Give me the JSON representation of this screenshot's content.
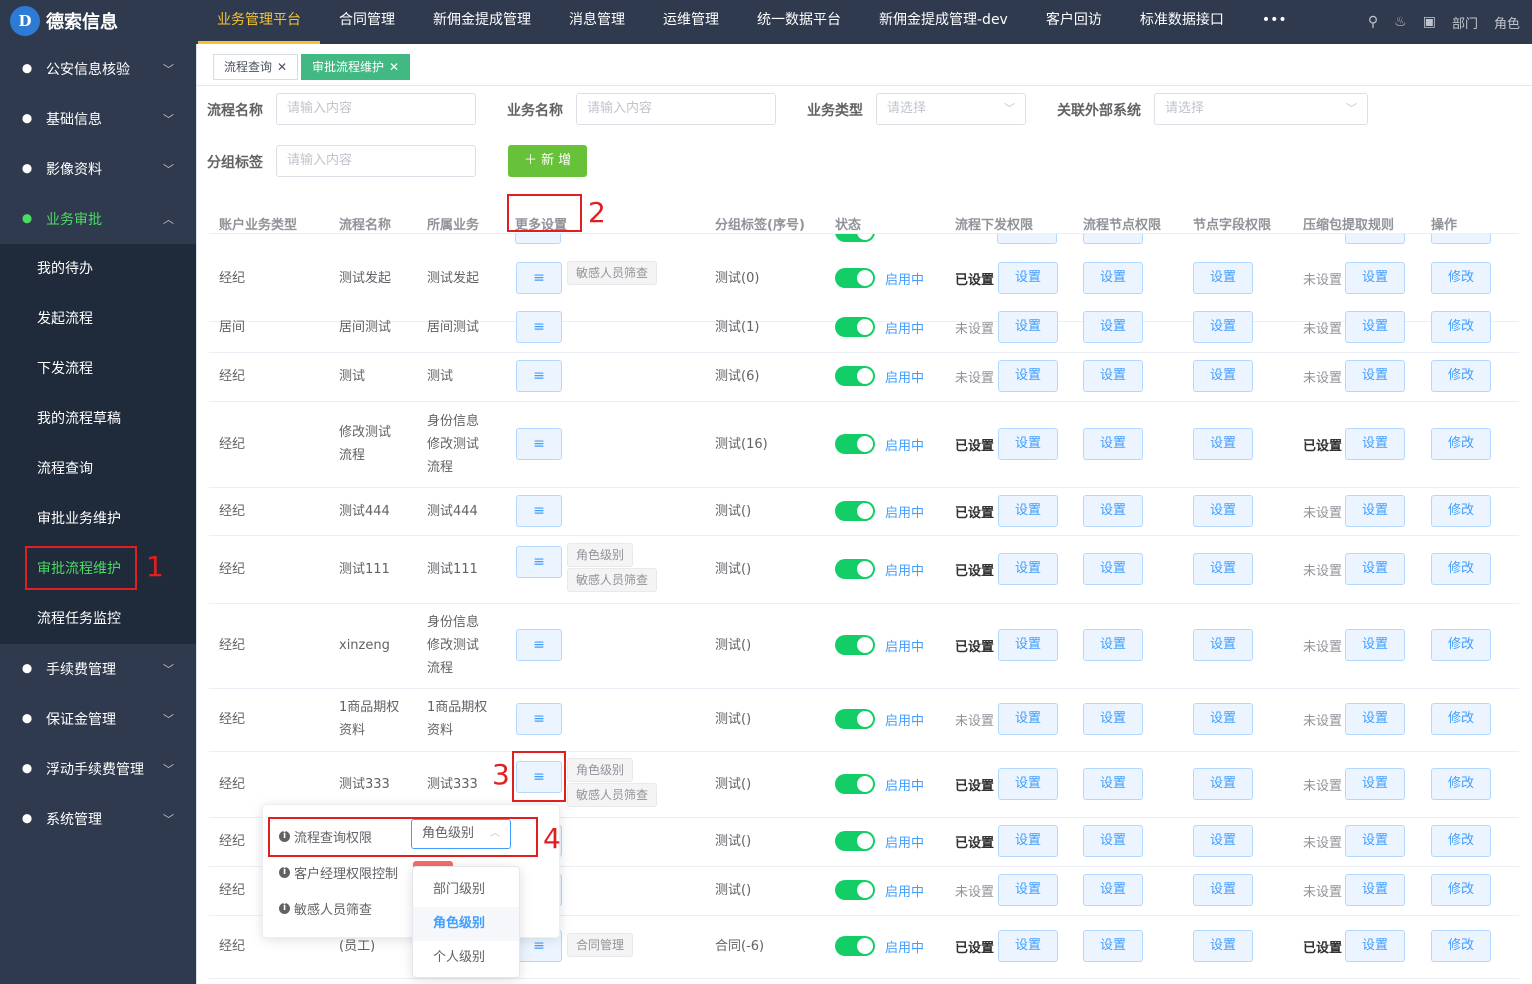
{
  "brand": {
    "name": "德索信息",
    "mark": "D"
  },
  "topnav": [
    "业务管理平台",
    "合同管理",
    "新佣金提成管理",
    "消息管理",
    "运维管理",
    "统一数据平台",
    "新佣金提成管理-dev",
    "客户回访",
    "标准数据接口",
    "•••"
  ],
  "topright": {
    "dept": "部门",
    "role": "角色"
  },
  "sidebar": {
    "groups": [
      "公安信息核验",
      "基础信息",
      "影像资料",
      "业务审批",
      "手续费管理",
      "保证金管理",
      "浮动手续费管理",
      "系统管理"
    ],
    "subs": [
      "我的待办",
      "发起流程",
      "下发流程",
      "我的流程草稿",
      "流程查询",
      "审批业务维护",
      "审批流程维护",
      "流程任务监控"
    ]
  },
  "tabs": [
    {
      "label": "流程查询"
    },
    {
      "label": "审批流程维护"
    }
  ],
  "filters": {
    "flow_name_label": "流程名称",
    "flow_name_ph": "请输入内容",
    "biz_name_label": "业务名称",
    "biz_name_ph": "请输入内容",
    "biz_type_label": "业务类型",
    "biz_type_ph": "请选择",
    "ext_sys_label": "关联外部系统",
    "ext_sys_ph": "请选择",
    "group_label": "分组标签",
    "group_ph": "请输入内容",
    "add_btn": "新 增"
  },
  "table": {
    "headers": [
      "账户业务类型",
      "流程名称",
      "所属业务",
      "更多设置",
      "分组标签(序号)",
      "状态",
      "流程下发权限",
      "流程节点权限",
      "节点字段权限",
      "压缩包提取规则",
      "操作"
    ],
    "status_on": "启用中",
    "set_btn": "设置",
    "edit_btn": "修改",
    "rows": [
      {
        "type": "经纪",
        "name": [
          "测试发起"
        ],
        "biz": [
          "测试发起"
        ],
        "tags": [
          "敏感人员筛查"
        ],
        "group": "测试(0)",
        "perm": "已设置",
        "zip": "未设置"
      },
      {
        "type": "居间",
        "name": [
          "居间测试"
        ],
        "biz": [
          "居间测试"
        ],
        "tags": [],
        "group": "测试(1)",
        "perm": "未设置",
        "zip": "未设置"
      },
      {
        "type": "经纪",
        "name": [
          "测试"
        ],
        "biz": [
          "测试"
        ],
        "tags": [],
        "group": "测试(6)",
        "perm": "未设置",
        "zip": "未设置"
      },
      {
        "type": "经纪",
        "name": [
          "修改测试",
          "流程"
        ],
        "biz": [
          "身份信息",
          "修改测试",
          "流程"
        ],
        "tags": [],
        "group": "测试(16)",
        "perm": "已设置",
        "zip": "已设置"
      },
      {
        "type": "经纪",
        "name": [
          "测试444"
        ],
        "biz": [
          "测试444"
        ],
        "tags": [],
        "group": "测试()",
        "perm": "已设置",
        "zip": "未设置"
      },
      {
        "type": "经纪",
        "name": [
          "测试111"
        ],
        "biz": [
          "测试111"
        ],
        "tags": [
          "角色级别",
          "敏感人员筛查"
        ],
        "group": "测试()",
        "perm": "已设置",
        "zip": "未设置"
      },
      {
        "type": "经纪",
        "name": [
          "xinzeng"
        ],
        "biz": [
          "身份信息",
          "修改测试",
          "流程"
        ],
        "tags": [],
        "group": "测试()",
        "perm": "已设置",
        "zip": "未设置"
      },
      {
        "type": "经纪",
        "name": [
          "1商品期权",
          "资料"
        ],
        "biz": [
          "1商品期权",
          "资料"
        ],
        "tags": [],
        "group": "测试()",
        "perm": "未设置",
        "zip": "未设置"
      },
      {
        "type": "经纪",
        "name": [
          "测试333"
        ],
        "biz": [
          "测试333"
        ],
        "tags": [
          "角色级别",
          "敏感人员筛查"
        ],
        "group": "测试()",
        "perm": "已设置",
        "zip": "未设置"
      },
      {
        "type": "经纪",
        "name": [],
        "biz": [],
        "tags": [],
        "group": "测试()",
        "perm": "已设置",
        "zip": "未设置"
      },
      {
        "type": "经纪",
        "name": [],
        "biz": [],
        "tags": [],
        "group": "测试()",
        "perm": "未设置",
        "zip": "未设置"
      },
      {
        "type": "经纪",
        "name": [
          "(员工)"
        ],
        "biz": [],
        "tags": [
          "合同管理"
        ],
        "group": "合同(-6)",
        "perm": "已设置",
        "zip": "已设置"
      }
    ]
  },
  "popover": {
    "rows": [
      "流程查询权限",
      "客户经理权限控制",
      "敏感人员筛查"
    ],
    "select_value": "角色级别",
    "options": [
      "部门级别",
      "角色级别",
      "个人级别"
    ]
  },
  "annotations": [
    "1",
    "2",
    "3",
    "4"
  ],
  "colors": {
    "sidebar": "#2f3a4e",
    "accent": "#42b983",
    "switch": "#13ce66",
    "primary": "#409eff",
    "topnav_active": "#f5c136",
    "annotation": "#e02020"
  }
}
